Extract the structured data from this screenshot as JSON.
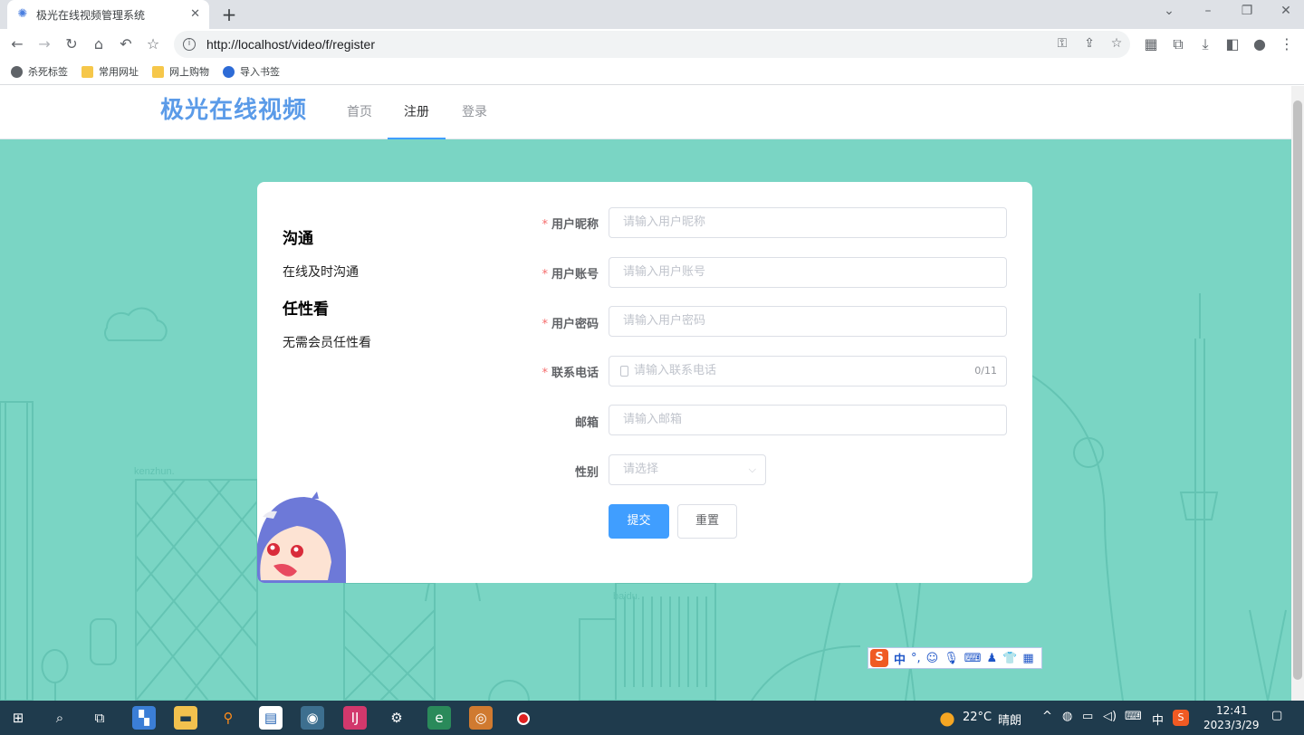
{
  "browser": {
    "tab_title": "极光在线视频管理系统",
    "tab_close": "✕",
    "new_tab": "+",
    "url": "http://localhost/video/f/register",
    "bookmarks": [
      {
        "label": "杀死标签",
        "icon": "globe-icon"
      },
      {
        "label": "常用网址",
        "icon": "folder-icon"
      },
      {
        "label": "网上购物",
        "icon": "folder-icon"
      },
      {
        "label": "导入书签",
        "icon": "gear-icon"
      }
    ]
  },
  "site": {
    "logo": "极光在线视频",
    "nav": [
      {
        "label": "首页",
        "active": false
      },
      {
        "label": "注册",
        "active": true
      },
      {
        "label": "登录",
        "active": false
      }
    ]
  },
  "intro": {
    "title1": "沟通",
    "text1": "在线及时沟通",
    "title2": "任性看",
    "text2": "无需会员任性看"
  },
  "form": {
    "required_mark": "*",
    "nickname": {
      "label": "用户昵称",
      "placeholder": "请输入用户昵称"
    },
    "account": {
      "label": "用户账号",
      "placeholder": "请输入用户账号"
    },
    "password": {
      "label": "用户密码",
      "placeholder": "请输入用户密码"
    },
    "phone": {
      "label": "联系电话",
      "placeholder": "请输入联系电话",
      "counter": "0/11"
    },
    "email": {
      "label": "邮箱",
      "placeholder": "请输入邮箱"
    },
    "gender": {
      "label": "性别",
      "placeholder": "请选择"
    },
    "submit": "提交",
    "reset": "重置"
  },
  "background": {
    "watermark1": "kenzhun.",
    "watermark2": "baidu."
  },
  "ime": {
    "logo": "S",
    "mode": "中",
    "punct": "°,"
  },
  "taskbar": {
    "weather_temp": "22°C",
    "weather_desc": "晴朗",
    "ime_lang": "中",
    "time": "12:41",
    "date": "2023/3/29"
  },
  "colors": {
    "accent": "#409eff",
    "page_bg": "#7ad5c4",
    "logo": "#5b9be8",
    "required": "#f56c6c"
  }
}
